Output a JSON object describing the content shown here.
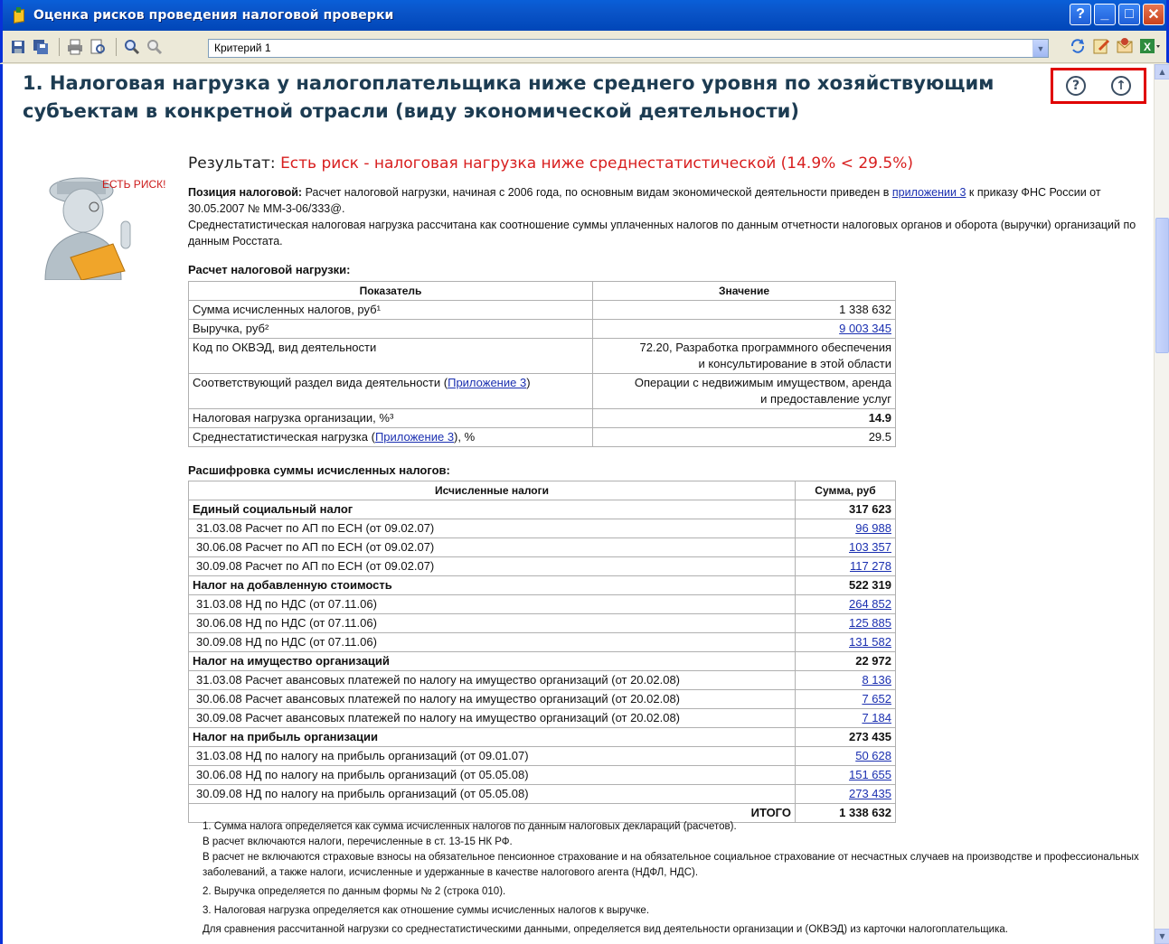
{
  "window": {
    "title": "Оценка рисков проведения налоговой проверки"
  },
  "toolbar": {
    "criterion_value": "Критерий 1",
    "icons": [
      "save-icon",
      "save-all-icon",
      "print-icon",
      "print-preview-icon",
      "zoom-in-icon",
      "zoom-out-icon"
    ],
    "right_icons": [
      "refresh-icon",
      "edit-icon",
      "mail-icon",
      "excel-icon"
    ]
  },
  "heading": "1. Налоговая нагрузка у налогоплательщика ниже среднего уровня по хозяйствующим субъектам в конкретной отрасли (виду экономической деятельности)",
  "risk_badge": "ЕСТЬ РИСК!",
  "result": {
    "label": "Результат:",
    "value": "Есть риск - налоговая нагрузка ниже среднестатистической (14.9% < 29.5%)"
  },
  "position": {
    "label": "Позиция налоговой:",
    "text1": "Расчет налоговой нагрузки, начиная с 2006 года, по основным видам экономической деятельности приведен в",
    "link": "приложении 3",
    "text2": "к приказу ФНС России от 30.05.2007 № ММ-3-06/333@.",
    "text3": "Среднестатистическая налоговая нагрузка рассчитана как соотношение суммы уплаченных налогов по данным отчетности налоговых органов и оборота (выручки) организаций по данным Росстата."
  },
  "calc": {
    "title": "Расчет налоговой нагрузки:",
    "headers": [
      "Показатель",
      "Значение"
    ],
    "rows": [
      {
        "name": "Сумма исчисленных налогов, руб¹",
        "value": "1 338 632"
      },
      {
        "name": "Выручка, руб²",
        "value": "9 003 345"
      },
      {
        "name": "Код по ОКВЭД, вид деятельности",
        "value_l1": "72.20, Разработка программного обеспечения",
        "value_l2": "и консультирование в этой области"
      },
      {
        "name_pre": "Соответствующий раздел вида деятельности (",
        "name_link": "Приложение 3",
        "name_post": ")",
        "value_l1": "Операции с недвижимым имуществом, аренда",
        "value_l2": "и предоставление услуг"
      },
      {
        "name": "Налоговая нагрузка организации, %³",
        "value": "14.9"
      },
      {
        "name_pre": "Среднестатистическая нагрузка (",
        "name_link": "Приложение 3",
        "name_post": "), %",
        "value": "29.5"
      }
    ]
  },
  "breakdown": {
    "title": "Расшифровка суммы исчисленных налогов:",
    "headers": [
      "Исчисленные налоги",
      "Сумма, руб"
    ],
    "g1": {
      "name": "Единый социальный налог",
      "total": "317 623",
      "items": [
        {
          "name": "31.03.08 Расчет по АП по ЕСН (от 09.02.07)",
          "value": "96 988"
        },
        {
          "name": "30.06.08 Расчет по АП по ЕСН (от 09.02.07)",
          "value": "103 357"
        },
        {
          "name": "30.09.08 Расчет по АП по ЕСН (от 09.02.07)",
          "value": "117 278"
        }
      ]
    },
    "g2": {
      "name": "Налог на добавленную стоимость",
      "total": "522 319",
      "items": [
        {
          "name": "31.03.08 НД по НДС (от 07.11.06)",
          "value": "264 852"
        },
        {
          "name": "30.06.08 НД по НДС (от 07.11.06)",
          "value": "125 885"
        },
        {
          "name": "30.09.08 НД по НДС (от 07.11.06)",
          "value": "131 582"
        }
      ]
    },
    "g3": {
      "name": "Налог на имущество организаций",
      "total": "22 972",
      "items": [
        {
          "name": "31.03.08 Расчет авансовых платежей по налогу на имущество организаций (от 20.02.08)",
          "value": "8 136"
        },
        {
          "name": "30.06.08 Расчет авансовых платежей по налогу на имущество организаций (от 20.02.08)",
          "value": "7 652"
        },
        {
          "name": "30.09.08 Расчет авансовых платежей по налогу на имущество организаций (от 20.02.08)",
          "value": "7 184"
        }
      ]
    },
    "g4": {
      "name": "Налог на прибыль организации",
      "total": "273 435",
      "items": [
        {
          "name": "31.03.08 НД по налогу на прибыль организаций (от 09.01.07)",
          "value": "50 628"
        },
        {
          "name": "30.06.08 НД по налогу на прибыль организаций (от 05.05.08)",
          "value": "151 655"
        },
        {
          "name": "30.09.08 НД по налогу на прибыль организаций (от 05.05.08)",
          "value": "273 435"
        }
      ]
    },
    "total_label": "ИТОГО",
    "total_value": "1 338 632"
  },
  "notes": {
    "n1": "1. Сумма налога определяется как сумма исчисленных налогов по данным налоговых деклараций (расчетов).",
    "n1b": "В расчет включаются налоги, перечисленные в ст. 13-15 НК РФ.",
    "n1c": "В расчет не включаются страховые взносы на обязательное пенсионное страхование и на обязательное социальное страхование от несчастных случаев на производстве и профессиональных заболеваний, а также налоги, исчисленные и удержанные в качестве налогового агента (НДФЛ, НДС).",
    "n2": "2. Выручка определяется по данным формы № 2 (строка 010).",
    "n3": "3. Налоговая нагрузка определяется как отношение суммы исчисленных налогов к выручке.",
    "n4": "Для сравнения рассчитанной нагрузки со среднестатистическими данными, определяется вид деятельности организации и (ОКВЭД) из карточки налогоплательщика."
  }
}
